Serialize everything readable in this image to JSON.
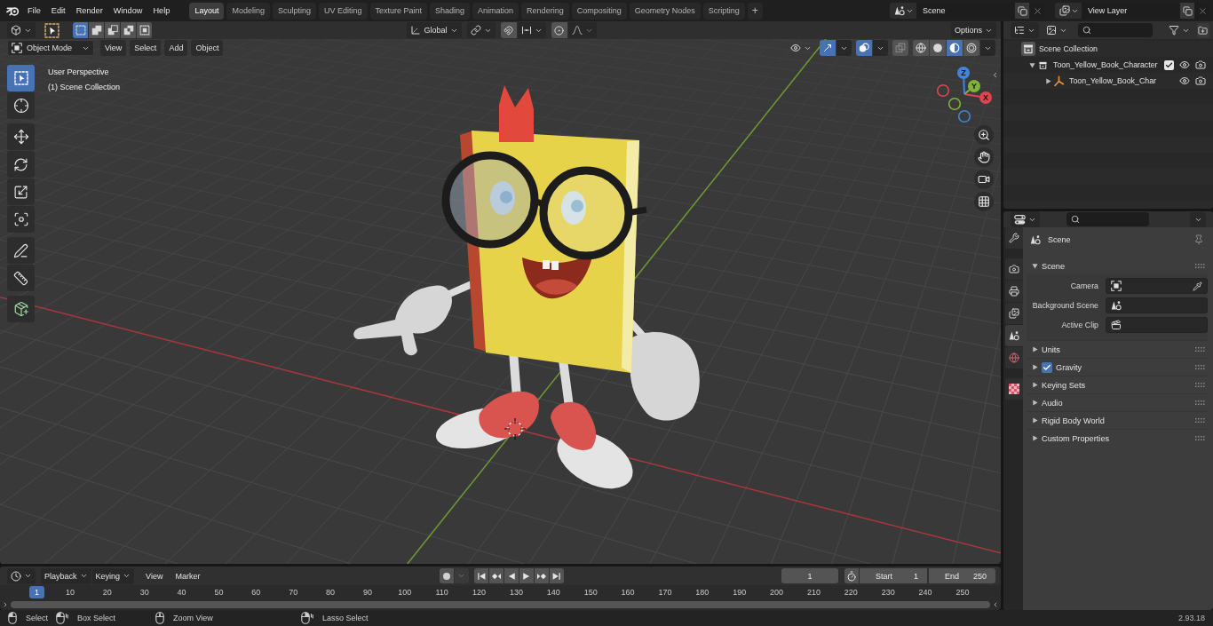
{
  "top_bar": {
    "menus": [
      "File",
      "Edit",
      "Render",
      "Window",
      "Help"
    ],
    "workspaces": [
      {
        "label": "Layout",
        "selected": true
      },
      {
        "label": "Modeling",
        "selected": false
      },
      {
        "label": "Sculpting",
        "selected": false
      },
      {
        "label": "UV Editing",
        "selected": false
      },
      {
        "label": "Texture Paint",
        "selected": false
      },
      {
        "label": "Shading",
        "selected": false
      },
      {
        "label": "Animation",
        "selected": false
      },
      {
        "label": "Rendering",
        "selected": false
      },
      {
        "label": "Compositing",
        "selected": false
      },
      {
        "label": "Geometry Nodes",
        "selected": false
      },
      {
        "label": "Scripting",
        "selected": false
      }
    ],
    "add_workspace": "+",
    "scene": "Scene",
    "view_layer": "View Layer"
  },
  "viewport": {
    "select_modes": [
      {
        "kind": "set",
        "selected": true
      },
      {
        "kind": "extend",
        "selected": false
      },
      {
        "kind": "subtract",
        "selected": false
      },
      {
        "kind": "difference",
        "selected": false
      },
      {
        "kind": "intersect",
        "selected": false
      }
    ],
    "orientation": "Global",
    "snap": {
      "on": false
    },
    "proportional": {
      "on": false
    },
    "options_menu": "Options",
    "mode": "Object Mode",
    "menus": [
      "View",
      "Select",
      "Add",
      "Object"
    ],
    "overlay_toggles": [
      {
        "kind": "gizmos",
        "on": true
      },
      {
        "kind": "overlays",
        "on": true
      },
      {
        "kind": "xray",
        "on": false
      }
    ],
    "shading": [
      {
        "kind": "wireframe",
        "selected": false
      },
      {
        "kind": "solid",
        "selected": false
      },
      {
        "kind": "material",
        "selected": true
      },
      {
        "kind": "rendered",
        "selected": false
      }
    ],
    "view_name": "User Perspective",
    "collection": "(1) Scene Collection",
    "tool_groups": [
      [
        {
          "kind": "select_box",
          "selected": true
        },
        {
          "kind": "cursor",
          "selected": false
        }
      ],
      [
        {
          "kind": "move",
          "selected": false
        },
        {
          "kind": "rotate",
          "selected": false
        },
        {
          "kind": "scale",
          "selected": false
        },
        {
          "kind": "transform",
          "selected": false
        }
      ],
      [
        {
          "kind": "annotate",
          "selected": false
        },
        {
          "kind": "measure",
          "selected": false
        }
      ],
      [
        {
          "kind": "add_cube",
          "selected": false
        }
      ]
    ],
    "gizmo_axes": [
      {
        "label": "X",
        "color": "#e0444f"
      },
      {
        "label": "Y",
        "color": "#7fb33a"
      },
      {
        "label": "Z",
        "color": "#3f86db"
      }
    ]
  },
  "timeline": {
    "dropdowns": [
      "Playback",
      "Keying"
    ],
    "menus": [
      "View",
      "Marker"
    ],
    "auto_keying": {
      "on": false
    },
    "current_frame": "1",
    "start_label": "Start",
    "start": "1",
    "end_label": "End",
    "end": "250",
    "playhead": "1",
    "ruler": [
      "10",
      "20",
      "30",
      "40",
      "50",
      "60",
      "70",
      "80",
      "90",
      "100",
      "110",
      "120",
      "130",
      "140",
      "150",
      "160",
      "170",
      "180",
      "190",
      "200",
      "210",
      "220",
      "230",
      "240",
      "250"
    ]
  },
  "outliner": {
    "tree": [
      {
        "kind": "scene_collection",
        "label": "Scene Collection",
        "children": [
          {
            "kind": "collection",
            "label": "Toon_Yellow_Book_Character",
            "expanded": true,
            "checked": true,
            "children": [
              {
                "kind": "object",
                "label": "Toon_Yellow_Book_Char",
                "expanded": false
              }
            ]
          }
        ]
      }
    ]
  },
  "properties": {
    "tab_groups": [
      [
        {
          "kind": "tool",
          "selected": false
        }
      ],
      [
        {
          "kind": "render",
          "selected": false
        },
        {
          "kind": "output",
          "selected": false
        },
        {
          "kind": "view_layer",
          "selected": false
        },
        {
          "kind": "scene",
          "selected": true
        },
        {
          "kind": "world",
          "selected": false
        }
      ],
      [
        {
          "kind": "texture",
          "selected": false
        }
      ]
    ],
    "context": "Scene",
    "panels": [
      {
        "title": "Scene",
        "expanded": true,
        "fields": [
          {
            "kind": "camera",
            "label": "Camera"
          },
          {
            "kind": "scene",
            "label": "Background Scene"
          },
          {
            "kind": "clip",
            "label": "Active Clip"
          }
        ]
      },
      {
        "title": "Units",
        "expanded": false
      },
      {
        "title": "Gravity",
        "expanded": false,
        "checkbox": {
          "checked": true
        }
      },
      {
        "title": "Keying Sets",
        "expanded": false
      },
      {
        "title": "Audio",
        "expanded": false
      },
      {
        "title": "Rigid Body World",
        "expanded": false
      },
      {
        "title": "Custom Properties",
        "expanded": false
      }
    ]
  },
  "status_bar": {
    "hints": [
      {
        "kind": "left_click",
        "label": "Select"
      },
      {
        "kind": "left_drag",
        "label": "Box Select"
      },
      {
        "kind": "middle_click",
        "label": "Zoom View"
      },
      {
        "kind": "right_drag",
        "label": "Lasso Select"
      }
    ],
    "version": "2.93.18"
  }
}
